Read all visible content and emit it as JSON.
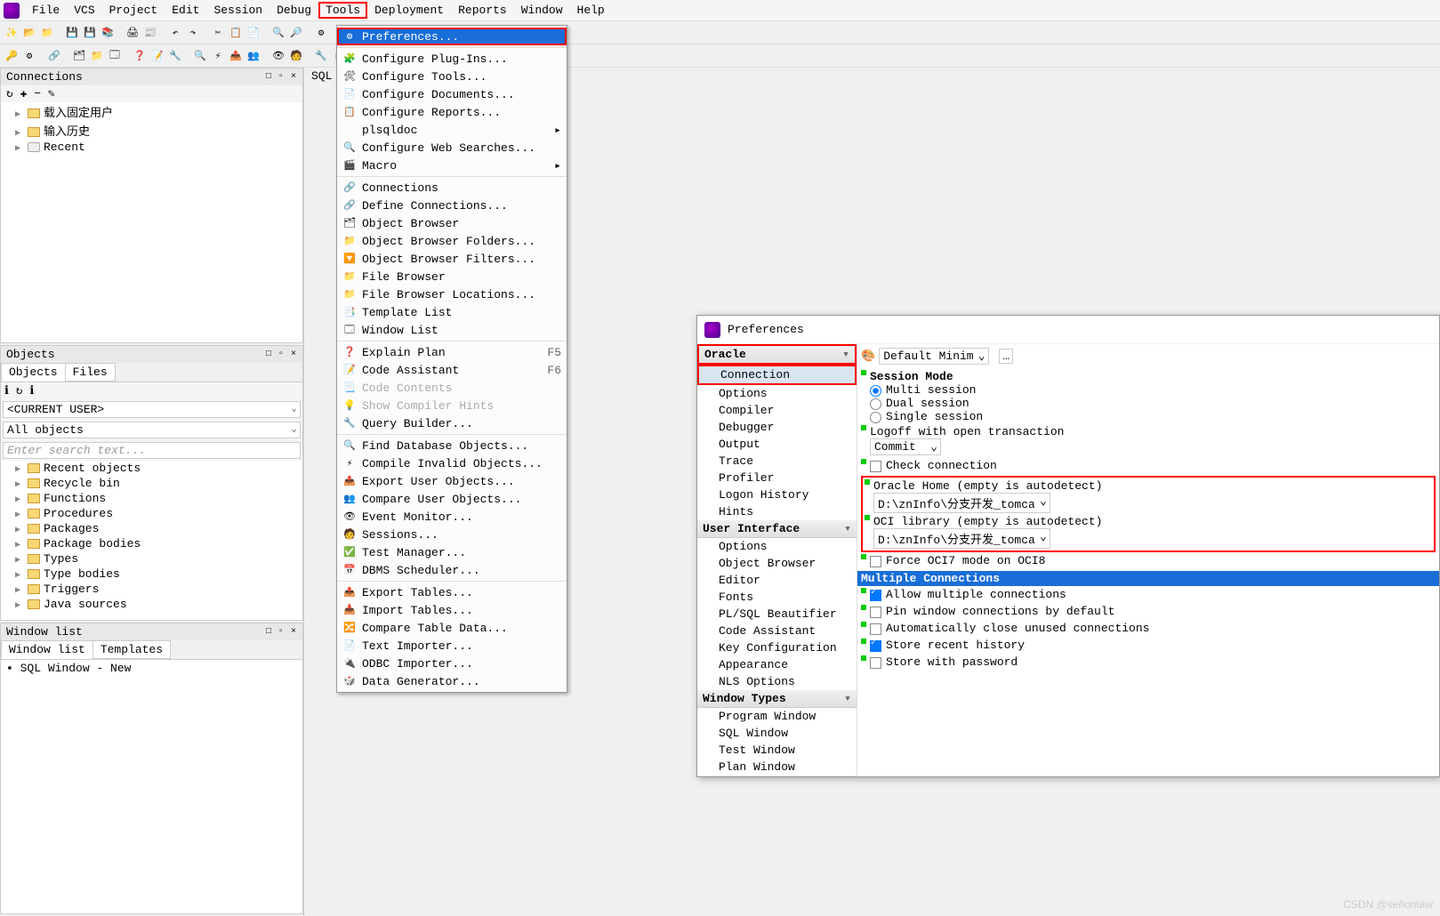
{
  "menubar": {
    "items": [
      "File",
      "VCS",
      "Project",
      "Edit",
      "Session",
      "Debug",
      "Tools",
      "Deployment",
      "Reports",
      "Window",
      "Help"
    ],
    "active": "Tools"
  },
  "sql_label": "SQL",
  "panels": {
    "connections": {
      "title": "Connections",
      "controls": "□ ▫ ×",
      "toolbar": "↻ ✚ − ✎",
      "tree": [
        {
          "label": "载入固定用户",
          "icon": "folder"
        },
        {
          "label": "输入历史",
          "icon": "folder"
        },
        {
          "label": "Recent",
          "icon": "recent"
        }
      ]
    },
    "objects": {
      "title": "Objects",
      "controls": "□ ▫ ×",
      "tabs": [
        "Objects",
        "Files"
      ],
      "current_user": "<CURRENT USER>",
      "all_objects": "All objects",
      "search_placeholder": "Enter search text...",
      "items": [
        "Recent objects",
        "Recycle bin",
        "Functions",
        "Procedures",
        "Packages",
        "Package bodies",
        "Types",
        "Type bodies",
        "Triggers",
        "Java sources"
      ]
    },
    "windowlist": {
      "title": "Window list",
      "controls": "□ ▫ ×",
      "tabs": [
        "Window list",
        "Templates"
      ],
      "items": [
        "SQL Window - New"
      ]
    }
  },
  "tools_menu": [
    [
      {
        "label": "Preferences...",
        "selected": true,
        "icon": "⚙"
      }
    ],
    [
      {
        "label": "Configure Plug-Ins...",
        "icon": "🧩"
      },
      {
        "label": "Configure Tools...",
        "icon": "🛠"
      },
      {
        "label": "Configure Documents...",
        "icon": "📄"
      },
      {
        "label": "Configure Reports...",
        "icon": "📋"
      },
      {
        "label": "plsqldoc",
        "arrow": true
      },
      {
        "label": "Configure Web Searches...",
        "icon": "🔍"
      },
      {
        "label": "Macro",
        "arrow": true,
        "icon": "🎬"
      }
    ],
    [
      {
        "label": "Connections",
        "icon": "🔗"
      },
      {
        "label": "Define Connections...",
        "icon": "🔗"
      },
      {
        "label": "Object Browser",
        "icon": "🗂"
      },
      {
        "label": "Object Browser Folders...",
        "icon": "📁"
      },
      {
        "label": "Object Browser Filters...",
        "icon": "🔽"
      },
      {
        "label": "File Browser",
        "icon": "📁"
      },
      {
        "label": "File Browser Locations...",
        "icon": "📁"
      },
      {
        "label": "Template List",
        "icon": "📑"
      },
      {
        "label": "Window List",
        "icon": "🗔"
      }
    ],
    [
      {
        "label": "Explain Plan",
        "key": "F5",
        "icon": "❓"
      },
      {
        "label": "Code Assistant",
        "key": "F6",
        "icon": "📝"
      },
      {
        "label": "Code Contents",
        "disabled": true,
        "icon": "📃"
      },
      {
        "label": "Show Compiler Hints",
        "disabled": true,
        "icon": "💡"
      },
      {
        "label": "Query Builder...",
        "icon": "🔧"
      }
    ],
    [
      {
        "label": "Find Database Objects...",
        "icon": "🔍"
      },
      {
        "label": "Compile Invalid Objects...",
        "icon": "⚡"
      },
      {
        "label": "Export User Objects...",
        "icon": "📤"
      },
      {
        "label": "Compare User Objects...",
        "icon": "👥"
      },
      {
        "label": "Event Monitor...",
        "icon": "👁"
      },
      {
        "label": "Sessions...",
        "icon": "🧑"
      },
      {
        "label": "Test Manager...",
        "icon": "✅"
      },
      {
        "label": "DBMS Scheduler...",
        "icon": "📅"
      }
    ],
    [
      {
        "label": "Export Tables...",
        "icon": "📤"
      },
      {
        "label": "Import Tables...",
        "icon": "📥"
      },
      {
        "label": "Compare Table Data...",
        "icon": "🔀"
      },
      {
        "label": "Text Importer...",
        "icon": "📄"
      },
      {
        "label": "ODBC Importer...",
        "icon": "🔌"
      },
      {
        "label": "Data Generator...",
        "icon": "🎲"
      }
    ]
  ],
  "prefs": {
    "title": "Preferences",
    "scheme": "Default Minim",
    "scheme_extra": "…",
    "categories": {
      "Oracle": [
        "Connection",
        "Options",
        "Compiler",
        "Debugger",
        "Output",
        "Trace",
        "Profiler",
        "Logon History",
        "Hints"
      ],
      "User Interface": [
        "Options",
        "Object Browser",
        "Editor",
        "Fonts",
        "PL/SQL Beautifier",
        "Code Assistant",
        "Key Configuration",
        "Appearance",
        "NLS Options"
      ],
      "Window Types": [
        "Program Window",
        "SQL Window",
        "Test Window",
        "Plan Window"
      ],
      "Tools": []
    },
    "selected_sub": "Connection",
    "session_mode": {
      "title": "Session Mode",
      "options": [
        "Multi session",
        "Dual session",
        "Single session"
      ],
      "checked": "Multi session"
    },
    "logoff": {
      "label": "Logoff with open transaction",
      "value": "Commit"
    },
    "check_conn": {
      "label": "Check connection",
      "checked": false
    },
    "oracle_home": {
      "label": "Oracle Home (empty is autodetect)",
      "value": "D:\\znInfo\\分支开发_tomca"
    },
    "oci_library": {
      "label": "OCI library (empty is autodetect)",
      "value": "D:\\znInfo\\分支开发_tomca"
    },
    "force_oci7": {
      "label": "Force OCI7 mode on OCI8",
      "checked": false
    },
    "multi_header": "Multiple Connections",
    "multi_opts": [
      {
        "label": "Allow multiple connections",
        "checked": true
      },
      {
        "label": "Pin window connections by default",
        "checked": false
      },
      {
        "label": "Automatically close unused connections",
        "checked": false
      },
      {
        "label": "Store recent history",
        "checked": true
      },
      {
        "label": "Store with password",
        "checked": false
      }
    ]
  },
  "watermark": "CSDN @señoritaw"
}
